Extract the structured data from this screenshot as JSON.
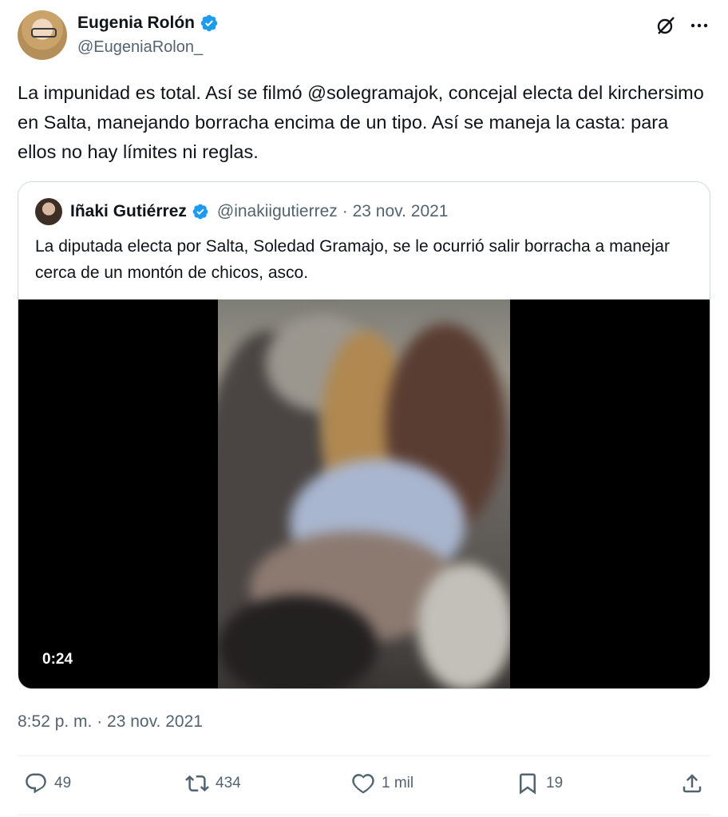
{
  "author": {
    "name": "Eugenia Rolón",
    "handle": "@EugeniaRolon_"
  },
  "tweet": {
    "text": "La impunidad es total. Así se filmó @solegramajok, concejal electa del kirchersimo en Salta, manejando borracha encima de un tipo. Así se maneja la casta: para ellos no hay límites ni reglas.",
    "timestamp": "8:52 p. m. · 23 nov. 2021"
  },
  "quoted": {
    "name": "Iñaki Gutiérrez",
    "handle": "@inakiigutierrez",
    "date": "· 23 nov. 2021",
    "text": "La diputada electa por Salta, Soledad Gramajo, se le ocurrió salir borracha a manejar cerca de un montón de chicos, asco.",
    "video_duration": "0:24"
  },
  "actions": {
    "replies": "49",
    "reposts": "434",
    "likes": "1 mil",
    "bookmarks": "19"
  },
  "colors": {
    "verified": "#1d9bf0",
    "secondary_text": "#536471",
    "border": "#cfd9de"
  },
  "icons": [
    "verified-badge-icon",
    "grok-icon",
    "more-icon",
    "reply-icon",
    "repost-icon",
    "like-icon",
    "bookmark-icon",
    "share-icon"
  ]
}
